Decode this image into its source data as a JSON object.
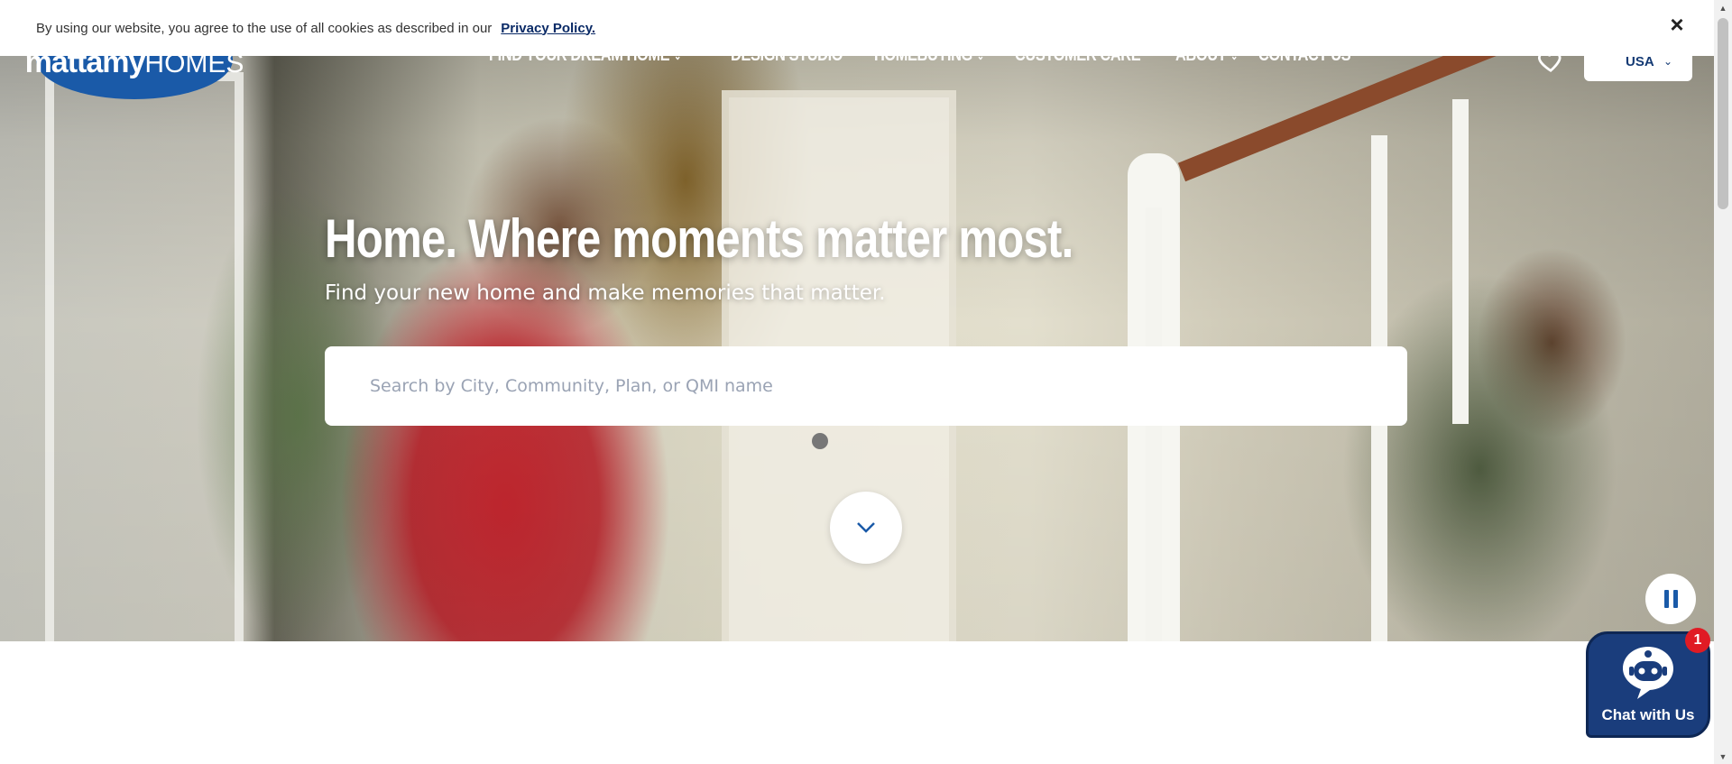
{
  "cookie_bar": {
    "message": "By using our website, you agree to the use of all cookies as described in our",
    "link_label": "Privacy Policy.",
    "close_icon": "×"
  },
  "header": {
    "logo_primary": "mattamy",
    "logo_secondary": "HOMES",
    "menu": [
      {
        "label": "FIND YOUR DREAM HOME",
        "has_dropdown": true
      },
      {
        "label": "DESIGN STUDIO",
        "has_dropdown": false
      },
      {
        "label": "HOMEBUYING",
        "has_dropdown": true
      },
      {
        "label": "CUSTOMER CARE",
        "has_dropdown": false
      },
      {
        "label": "ABOUT",
        "has_dropdown": true
      },
      {
        "label": "CONTACT US",
        "has_dropdown": false
      }
    ],
    "favorites_icon": "heart-icon",
    "country_selector": "USA"
  },
  "hero": {
    "headline": "Home. Where moments matter most.",
    "subheadline": "Find your new home and make memories that matter.",
    "search_placeholder": "Search by City, Community, Plan, or QMI name",
    "scroll_icon": "chevron-down-icon",
    "pause_icon": "pause-icon"
  },
  "chat": {
    "label": "Chat with Us",
    "badge_count": "1",
    "icon": "robot-icon"
  },
  "colors": {
    "brand_blue": "#1a5aa8",
    "chat_navy": "#1a3d7c",
    "badge_red": "#e01b24",
    "link_navy": "#0a2a66"
  }
}
